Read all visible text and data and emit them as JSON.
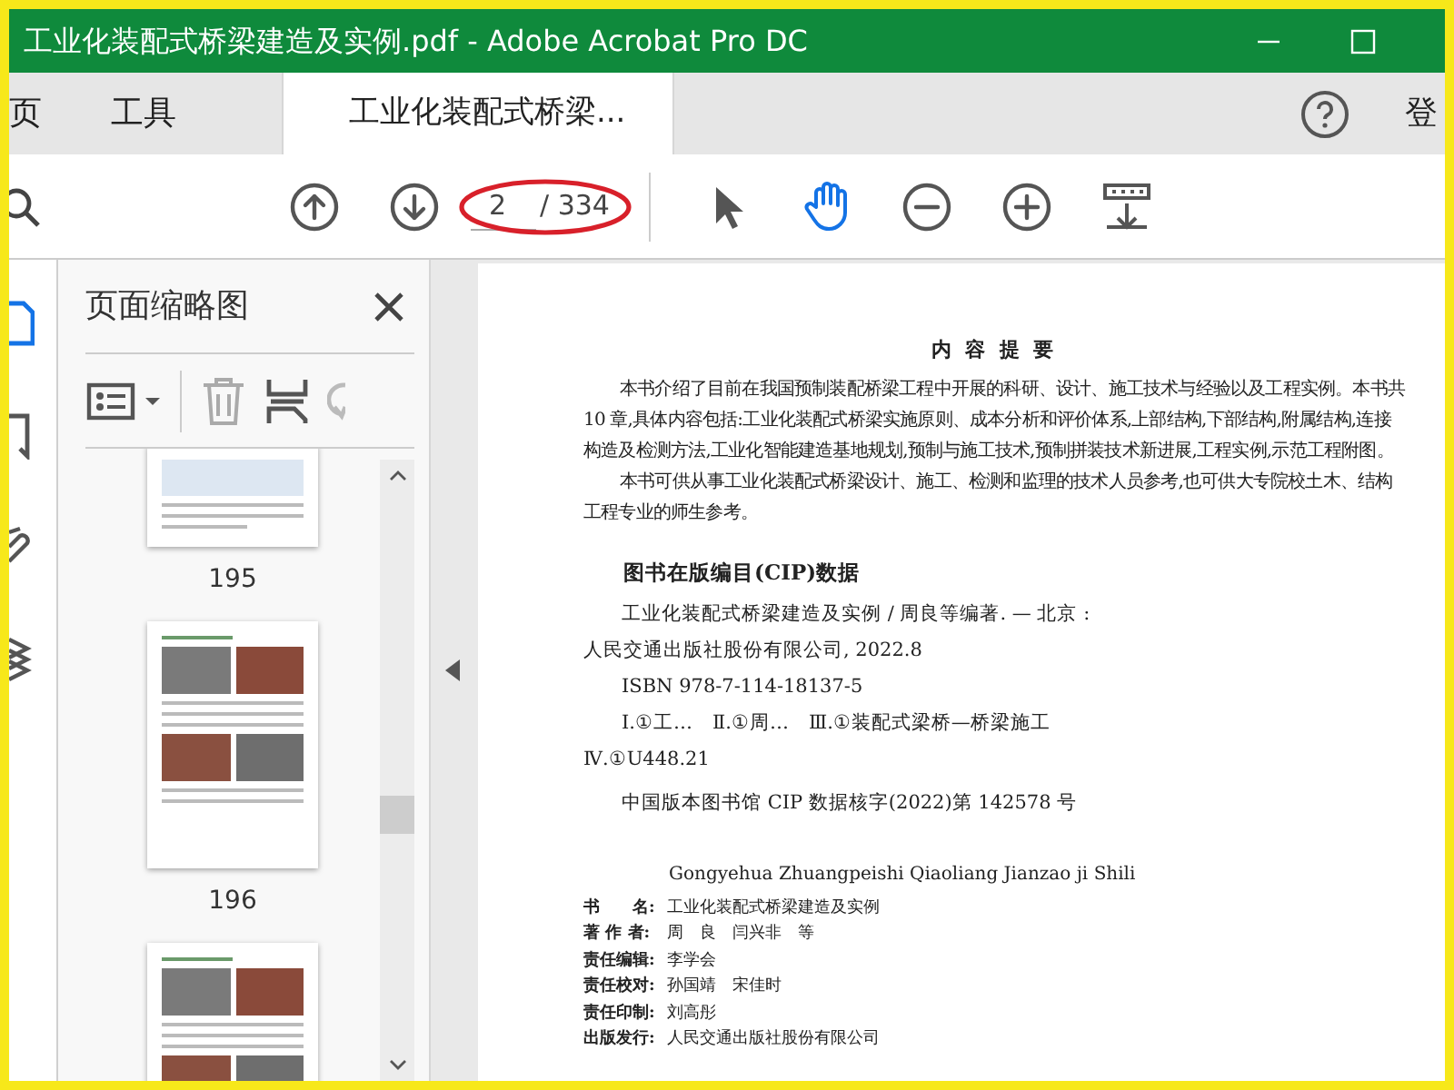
{
  "window": {
    "title": "工业化装配式桥梁建造及实例.pdf - Adobe Acrobat Pro DC"
  },
  "tabs": [
    {
      "kind": "nav",
      "label": "页",
      "selected": false
    },
    {
      "kind": "nav",
      "label": "工具",
      "selected": false
    },
    {
      "kind": "doc",
      "label": "工业化装配式桥梁...",
      "selected": true
    }
  ],
  "account": {
    "label": "登"
  },
  "toolbar": {
    "page_value": "2",
    "page_total": "/ 334",
    "hand_tool_selected": true,
    "annotation_circle": true
  },
  "sidebar": {
    "title": "页面缩略图",
    "thumbnails": [
      {
        "label": "195",
        "kind": "diagram"
      },
      {
        "label": "196",
        "kind": "photos"
      },
      {
        "kind": "photos"
      }
    ]
  },
  "document": {
    "heading": "内 容 提 要",
    "paragraphs": [
      "本书介绍了目前在我国预制装配桥梁工程中开展的科研、设计、施工技术与经验以及工程实例。本书共10 章,具体内容包括:工业化装配式桥梁实施原则、成本分析和评价体系,上部结构,下部结构,附属结构,连接构造及检测方法,工业化智能建造基地规划,预制与施工技术,预制拼装技术新进展,工程实例,示范工程附图。",
      "本书可供从事工业化装配式桥梁设计、施工、检测和监理的技术人员参考,也可供大专院校土木、结构工程专业的师生参考。"
    ],
    "cip_heading": "图书在版编目(CIP)数据",
    "cip_paragraphs": [
      "工业化装配式桥梁建造及实例 / 周良等编著. — 北京 : 人民交通出版社股份有限公司, 2022.8",
      "ISBN 978-7-114-18137-5",
      "Ⅰ.①工…　Ⅱ.①周…　Ⅲ.①装配式梁桥—桥梁施工Ⅳ.①U448.21",
      "中国版本图书馆 CIP 数据核字(2022)第 142578 号"
    ],
    "pinyin": "Gongyehua Zhuangpeishi Qiaoliang Jianzao ji Shili",
    "credits": [
      {
        "label": "书　　名:",
        "value": "工业化装配式桥梁建造及实例"
      },
      {
        "label": "著 作 者:",
        "value": "周　良　闫兴非　等"
      },
      {
        "label": "责任编辑:",
        "value": "李学会"
      },
      {
        "label": "责任校对:",
        "value": "孙国靖　宋佳时"
      },
      {
        "label": "责任印制:",
        "value": "刘高彤"
      },
      {
        "label": "出版发行:",
        "value": "人民交通出版社股份有限公司"
      }
    ]
  }
}
